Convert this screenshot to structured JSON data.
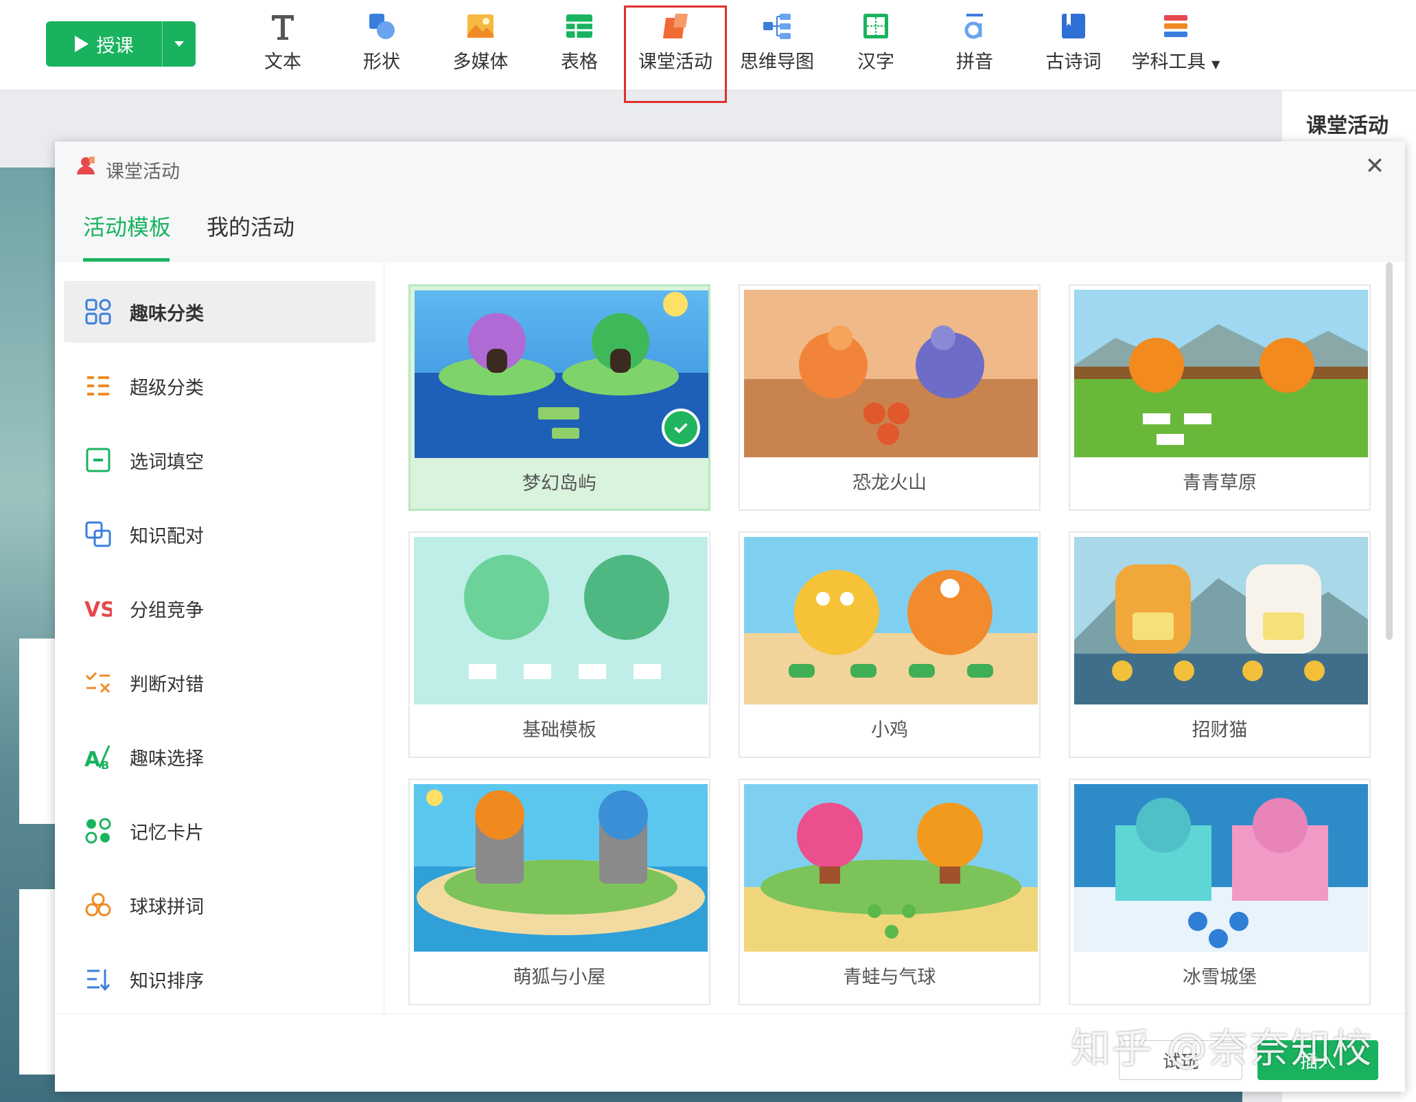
{
  "toolbar": {
    "lecture_label": "授课",
    "tools": [
      {
        "label": "文本",
        "icon": "text-icon"
      },
      {
        "label": "形状",
        "icon": "shape-icon"
      },
      {
        "label": "多媒体",
        "icon": "image-icon"
      },
      {
        "label": "表格",
        "icon": "table-icon"
      },
      {
        "label": "课堂活动",
        "icon": "activity-icon",
        "highlighted": true
      },
      {
        "label": "思维导图",
        "icon": "mindmap-icon"
      },
      {
        "label": "汉字",
        "icon": "hanzi-icon"
      },
      {
        "label": "拼音",
        "icon": "pinyin-icon"
      },
      {
        "label": "古诗词",
        "icon": "poem-icon"
      },
      {
        "label": "学科工具",
        "icon": "subject-tools-icon",
        "has_dropdown": true
      }
    ]
  },
  "side_panel": {
    "title": "课堂活动"
  },
  "modal": {
    "title": "课堂活动",
    "tabs": [
      "活动模板",
      "我的活动"
    ],
    "active_tab": "活动模板",
    "categories": [
      {
        "label": "趣味分类",
        "icon": "grid-icon",
        "color": "#3b7ddd"
      },
      {
        "label": "超级分类",
        "icon": "list-icon",
        "color": "#f08a24"
      },
      {
        "label": "选词填空",
        "icon": "fill-blank-icon",
        "color": "#19b35f"
      },
      {
        "label": "知识配对",
        "icon": "pair-icon",
        "color": "#3b7ddd"
      },
      {
        "label": "分组竞争",
        "icon": "vs-icon",
        "color": "#e5484d"
      },
      {
        "label": "判断对错",
        "icon": "check-cross-icon",
        "color": "#f08a24"
      },
      {
        "label": "趣味选择",
        "icon": "choice-icon",
        "color": "#19b35f"
      },
      {
        "label": "记忆卡片",
        "icon": "memory-card-icon",
        "color": "#19b35f"
      },
      {
        "label": "球球拼词",
        "icon": "balls-icon",
        "color": "#f08a24"
      },
      {
        "label": "知识排序",
        "icon": "sort-icon",
        "color": "#3b7ddd"
      }
    ],
    "active_category": "趣味分类",
    "templates": [
      {
        "name": "梦幻岛屿",
        "selected": true,
        "theme": "island"
      },
      {
        "name": "恐龙火山",
        "theme": "dino"
      },
      {
        "name": "青青草原",
        "theme": "grass"
      },
      {
        "name": "基础模板",
        "theme": "basic"
      },
      {
        "name": "小鸡",
        "theme": "chick"
      },
      {
        "name": "招财猫",
        "theme": "cat"
      },
      {
        "name": "萌狐与小屋",
        "theme": "fox"
      },
      {
        "name": "青蛙与气球",
        "theme": "frog"
      },
      {
        "name": "冰雪城堡",
        "theme": "ice"
      }
    ],
    "footer": {
      "try_label": "试玩",
      "ok_label": "插入"
    }
  },
  "watermark": "知乎 @奈奈知校",
  "colors": {
    "accent": "#19b35f",
    "highlight": "#e0312c"
  }
}
